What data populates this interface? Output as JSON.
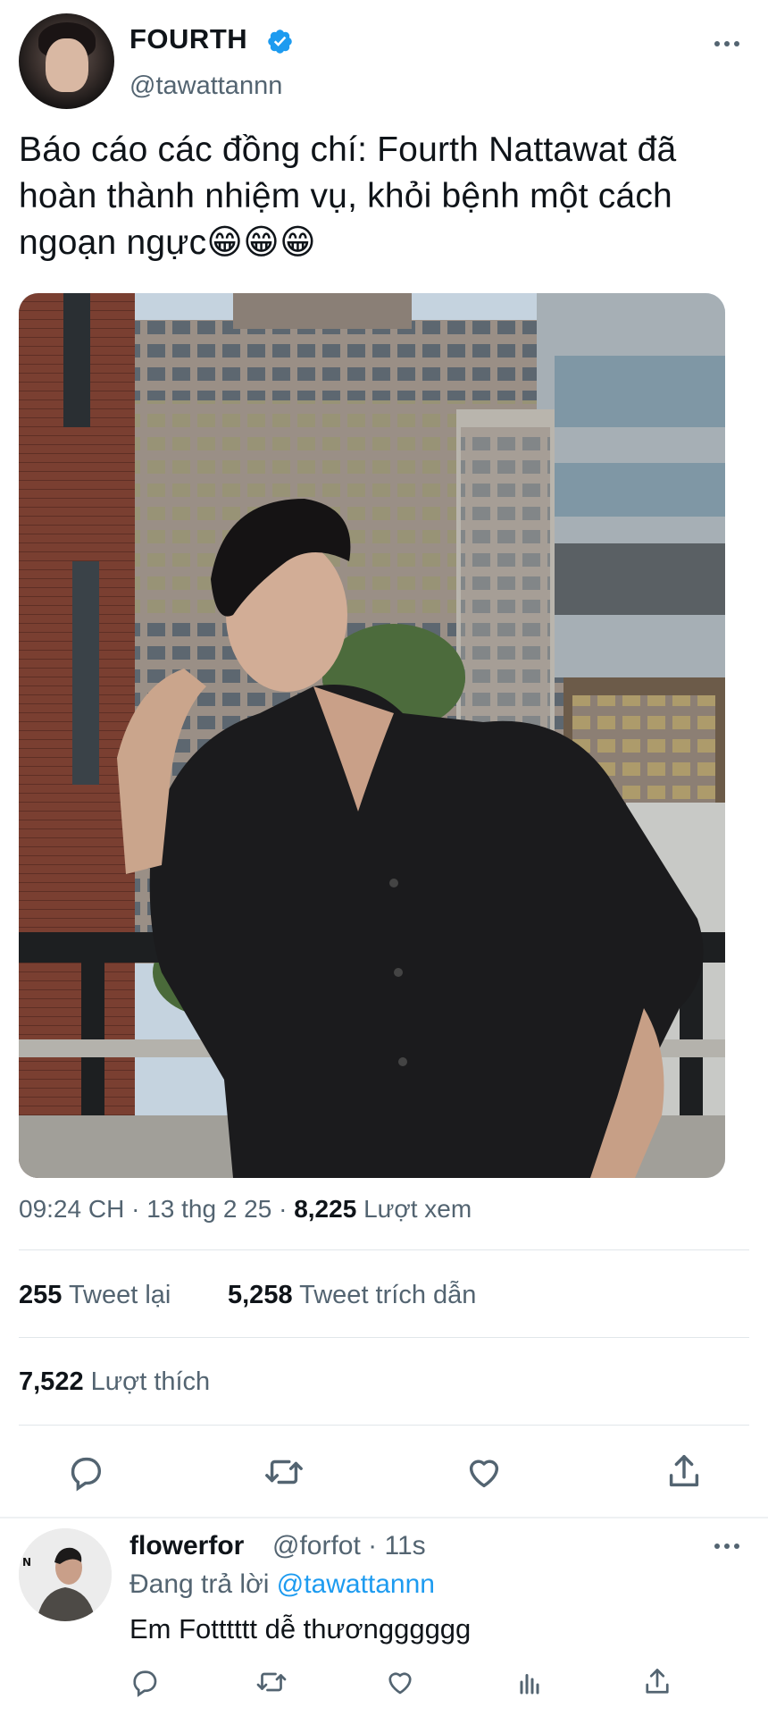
{
  "author": {
    "display_name": "FOURTH",
    "handle": "@tawattannn",
    "verified": true,
    "avatar": "profile-photo"
  },
  "tweet": {
    "text": "Báo cáo các đồng chí: Fourth Nattawat đã hoàn thành nhiệm vụ, khỏi bệnh một cách ngoạn ngực😁😁😁",
    "image": "photo-man-black-shirt-on-balcony",
    "time": "09:24 CH",
    "date": "13 thg 2 25",
    "views_count": "8,225",
    "views_label": "Lượt xem"
  },
  "stats": {
    "retweets_count": "255",
    "retweets_label": "Tweet lại",
    "quotes_count": "5,258",
    "quotes_label": "Tweet trích dẫn",
    "likes_count": "7,522",
    "likes_label": "Lượt thích"
  },
  "actions": [
    "reply-icon",
    "retweet-icon",
    "like-icon",
    "share-icon"
  ],
  "reply": {
    "display_name": "flowerfor",
    "handle": "@forfot",
    "dot": "·",
    "time": "11s",
    "replying_prefix": "Đang trả lời",
    "replying_to": "@tawattannn",
    "text": "Em Fotttttt dễ thươngggggg",
    "actions": [
      "reply-icon",
      "retweet-icon",
      "like-icon",
      "analytics-icon",
      "share-icon"
    ]
  },
  "colors": {
    "text": "#0f1419",
    "secondary": "#536471",
    "accent": "#1d9bf0",
    "divider": "#e1e6ea"
  }
}
